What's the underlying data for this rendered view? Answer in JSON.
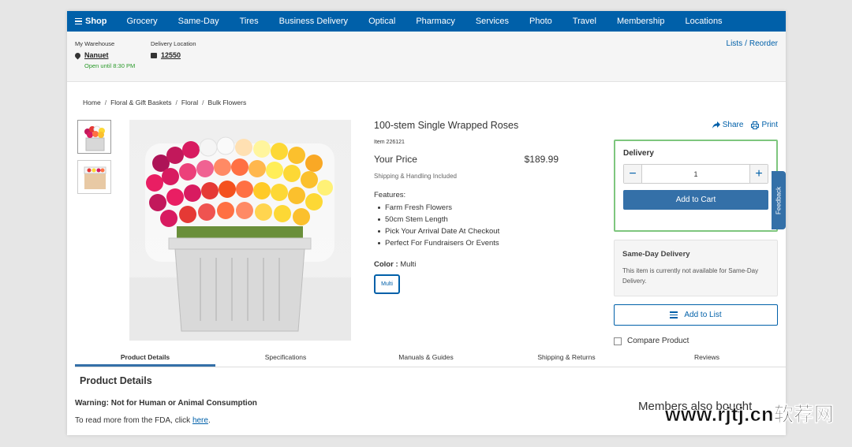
{
  "nav": {
    "shop": "Shop",
    "items": [
      "Grocery",
      "Same-Day",
      "Tires",
      "Business Delivery",
      "Optical",
      "Pharmacy",
      "Services",
      "Photo",
      "Travel",
      "Membership",
      "Locations"
    ]
  },
  "subbar": {
    "warehouse_label": "My Warehouse",
    "warehouse_name": "Nanuet",
    "open_until": "Open until 8:30 PM",
    "delivery_label": "Delivery Location",
    "delivery_zip": "12550",
    "lists": "Lists",
    "reorder": "Reorder"
  },
  "breadcrumb": [
    "Home",
    "Floral & Gift Baskets",
    "Floral",
    "Bulk Flowers"
  ],
  "product": {
    "title": "100-stem Single Wrapped Roses",
    "item": "Item  226121",
    "price_label": "Your Price",
    "price": "$189.99",
    "shipping": "Shipping & Handling Included",
    "features_label": "Features:",
    "features": [
      "Farm Fresh Flowers",
      "50cm Stem Length",
      "Pick Your Arrival Date At Checkout",
      "Perfect For Fundraisers Or Events"
    ],
    "color_label": "Color :",
    "color_value": "Multi",
    "swatch": "Multi"
  },
  "actions": {
    "share": "Share",
    "print": "Print"
  },
  "delivery": {
    "title": "Delivery",
    "qty": "1",
    "add_to_cart": "Add to Cart"
  },
  "feedback": "Feedback",
  "sameday": {
    "title": "Same-Day Delivery",
    "text": "This item is currently not available for Same-Day Delivery."
  },
  "add_to_list": "Add to List",
  "compare": "Compare Product",
  "tabs": [
    "Product Details",
    "Specifications",
    "Manuals & Guides",
    "Shipping & Returns",
    "Reviews"
  ],
  "details": {
    "heading": "Product Details",
    "warning": "Warning: Not for Human or Animal Consumption",
    "fda_prefix": "To read more from the FDA, click ",
    "fda_link": "here",
    "fda_suffix": "."
  },
  "members_also": "Members also bought",
  "watermark": "www.rjtj.cn软荐网",
  "colors": {
    "brand_blue": "#0060a9",
    "button_blue": "#3470a8",
    "green_border": "#7ec67e",
    "open_green": "#2a9a2a"
  },
  "icons": [
    "menu-icon",
    "pin-icon",
    "truck-icon",
    "share-icon",
    "print-icon",
    "minus-icon",
    "plus-icon",
    "list-icon"
  ]
}
